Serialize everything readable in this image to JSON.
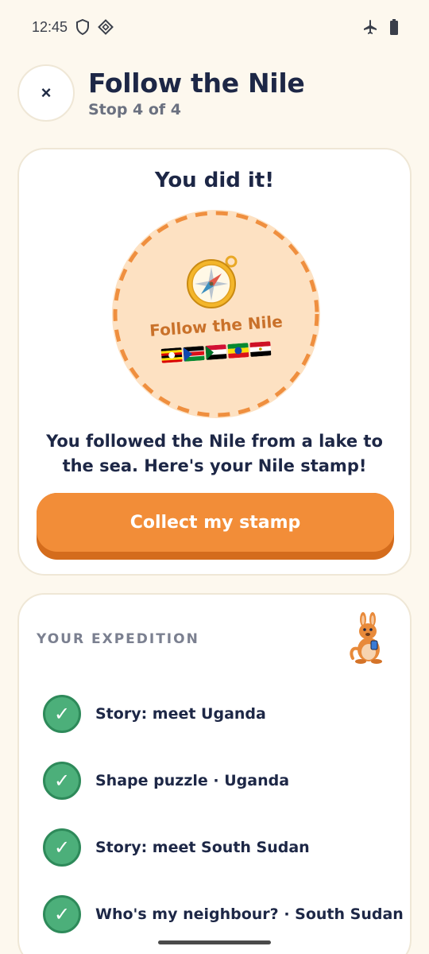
{
  "status_bar": {
    "time": "12:45"
  },
  "header": {
    "close_label": "×",
    "title": "Follow the Nile",
    "subtitle": "Stop 4 of 4"
  },
  "completion": {
    "title": "You did it!",
    "stamp_label": "Follow the Nile",
    "flags": [
      "uganda-flag",
      "south-sudan-flag",
      "sudan-flag",
      "ethiopia-flag",
      "egypt-flag"
    ],
    "message": "You followed the Nile from a lake to the sea. Here's your Nile stamp!",
    "cta_label": "Collect my stamp"
  },
  "expedition": {
    "section_label": "YOUR EXPEDITION",
    "check_glyph": "✓",
    "steps": [
      {
        "label": "Story: meet Uganda"
      },
      {
        "label": "Shape puzzle · Uganda"
      },
      {
        "label": "Story: meet South Sudan"
      },
      {
        "label": "Who's my neighbour? · South Sudan"
      }
    ]
  },
  "colors": {
    "background": "#fdf8ee",
    "accent": "#f28d38",
    "check": "#4caf7a",
    "text": "#1d2746"
  }
}
